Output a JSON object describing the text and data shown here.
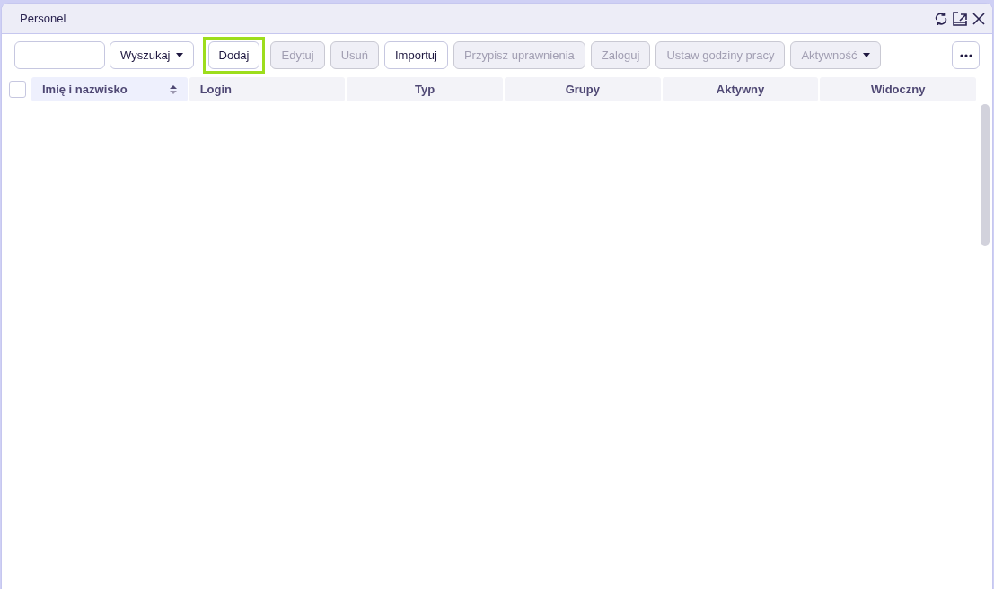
{
  "window": {
    "title": "Personel"
  },
  "toolbar": {
    "buttons": [
      {
        "label": "Wyszukaj",
        "kind": "dropdown",
        "disabled": false,
        "focused": false
      },
      {
        "label": "Dodaj",
        "kind": "button",
        "disabled": false,
        "focused": true
      },
      {
        "label": "Edytuj",
        "kind": "button",
        "disabled": true,
        "focused": false
      },
      {
        "label": "Usuń",
        "kind": "button",
        "disabled": true,
        "focused": false
      },
      {
        "label": "Importuj",
        "kind": "button",
        "disabled": false,
        "focused": false
      },
      {
        "label": "Przypisz uprawnienia",
        "kind": "button",
        "disabled": true,
        "focused": false
      },
      {
        "label": "Zaloguj",
        "kind": "button",
        "disabled": true,
        "focused": false
      },
      {
        "label": "Ustaw godziny pracy",
        "kind": "button",
        "disabled": true,
        "focused": false
      },
      {
        "label": "Aktywność",
        "kind": "dropdown",
        "disabled": true,
        "focused": false
      }
    ]
  },
  "table": {
    "select_all": {
      "checked": false
    },
    "columns": [
      {
        "label": "Imię i nazwisko",
        "selected": true
      },
      {
        "label": "Login",
        "selected": false
      },
      {
        "label": "Typ",
        "selected": false
      },
      {
        "label": "Grupy",
        "selected": false
      },
      {
        "label": "Aktywny",
        "selected": false
      },
      {
        "label": "Widoczny",
        "selected": false
      }
    ]
  }
}
